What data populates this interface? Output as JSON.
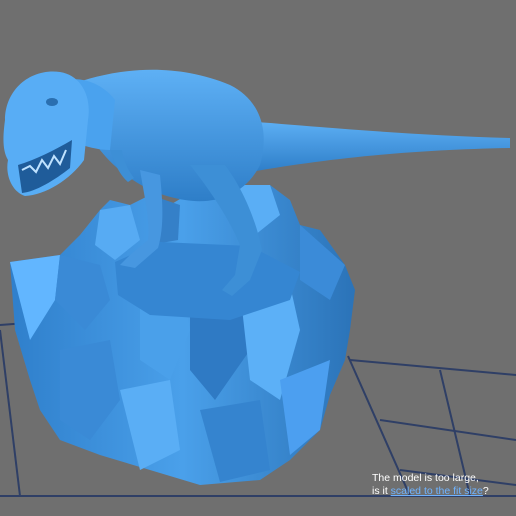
{
  "viewport": {
    "background_color": "#6f6f6f",
    "grid_color": "#2f3f66",
    "model_color": "#3d8fd6",
    "model_name": "tyrannosaurus-on-crystal-base"
  },
  "notice": {
    "line1": "The model is too large,",
    "line2_prefix": "is it ",
    "link_label": "scaled to the fit size",
    "line2_suffix": "?",
    "link_color": "#6fb3ff"
  }
}
